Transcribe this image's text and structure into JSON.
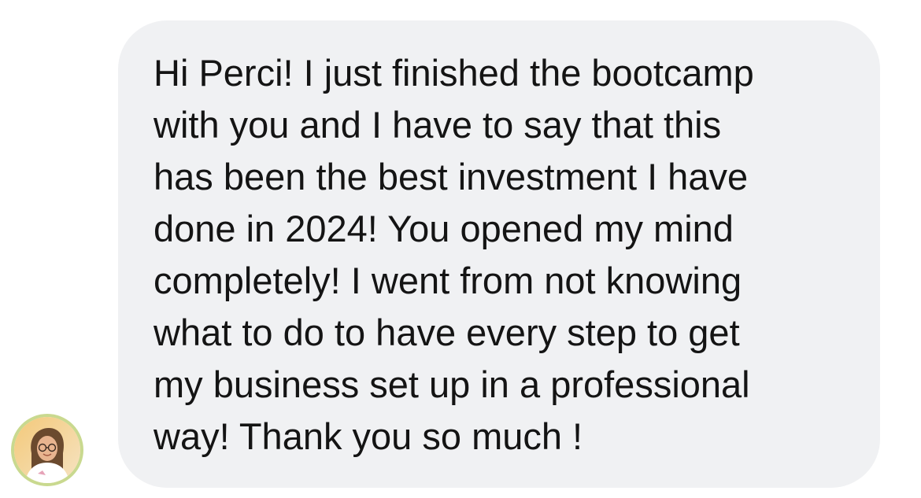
{
  "message": {
    "lines": [
      "Hi Perci! I just finished the bootcamp",
      "with you and I have to say that this",
      "has been the best investment I have",
      "done in 2024! You opened my mind",
      "completely! I went from not knowing",
      "what to do to have every step to get",
      "my business set up in a professional",
      "way! Thank you so much !"
    ]
  },
  "colors": {
    "bubble_background": "#f0f1f3",
    "text": "#141414",
    "avatar_ring": "#c9d98f"
  },
  "icons": {
    "avatar": "sender-avatar-photo"
  }
}
